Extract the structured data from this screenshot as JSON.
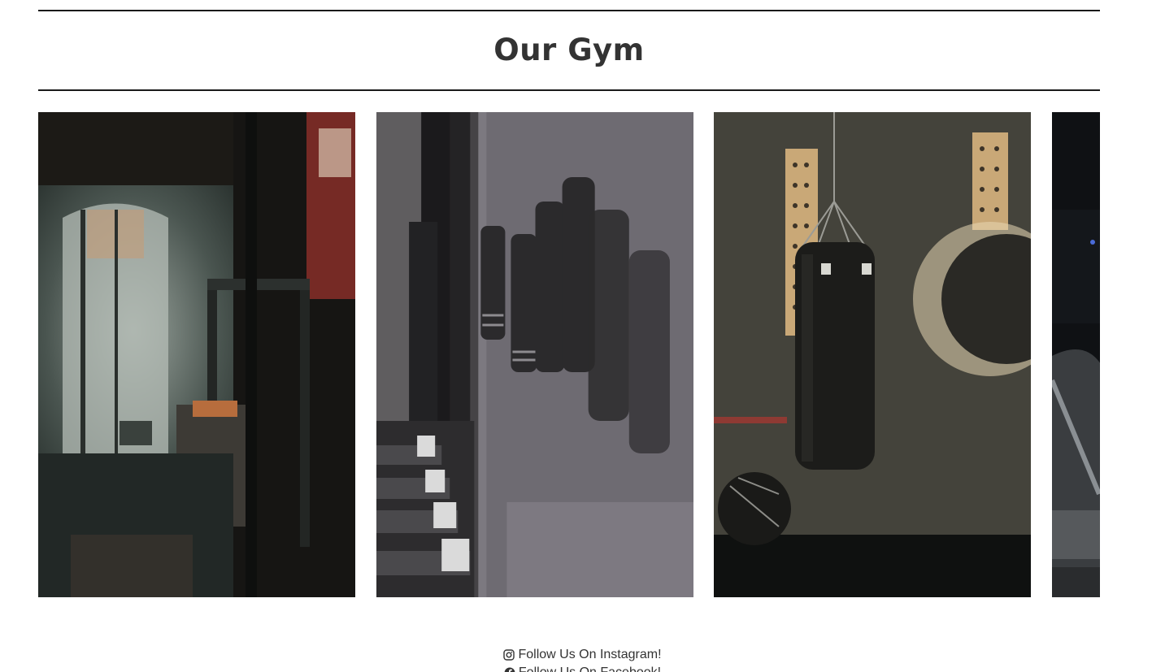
{
  "header": {
    "title": "Our Gym"
  },
  "gallery": {
    "images": [
      {
        "name": "gym-interior-photo",
        "icon": "gym-rack-window"
      },
      {
        "name": "jump-ropes-dumbbells-photo",
        "icon": "jump-ropes-dumbbells"
      },
      {
        "name": "punching-bag-photo",
        "icon": "punching-bag"
      },
      {
        "name": "treadmill-photo",
        "icon": "treadmill"
      }
    ]
  },
  "social": {
    "instagram_label": "Follow Us On Instagram!",
    "facebook_label": "Follow Us On Facebook!",
    "instagram_icon": "instagram-icon",
    "facebook_icon": "facebook-icon"
  },
  "colors": {
    "text": "#333333",
    "rule": "#1a1a1a",
    "background": "#ffffff"
  }
}
